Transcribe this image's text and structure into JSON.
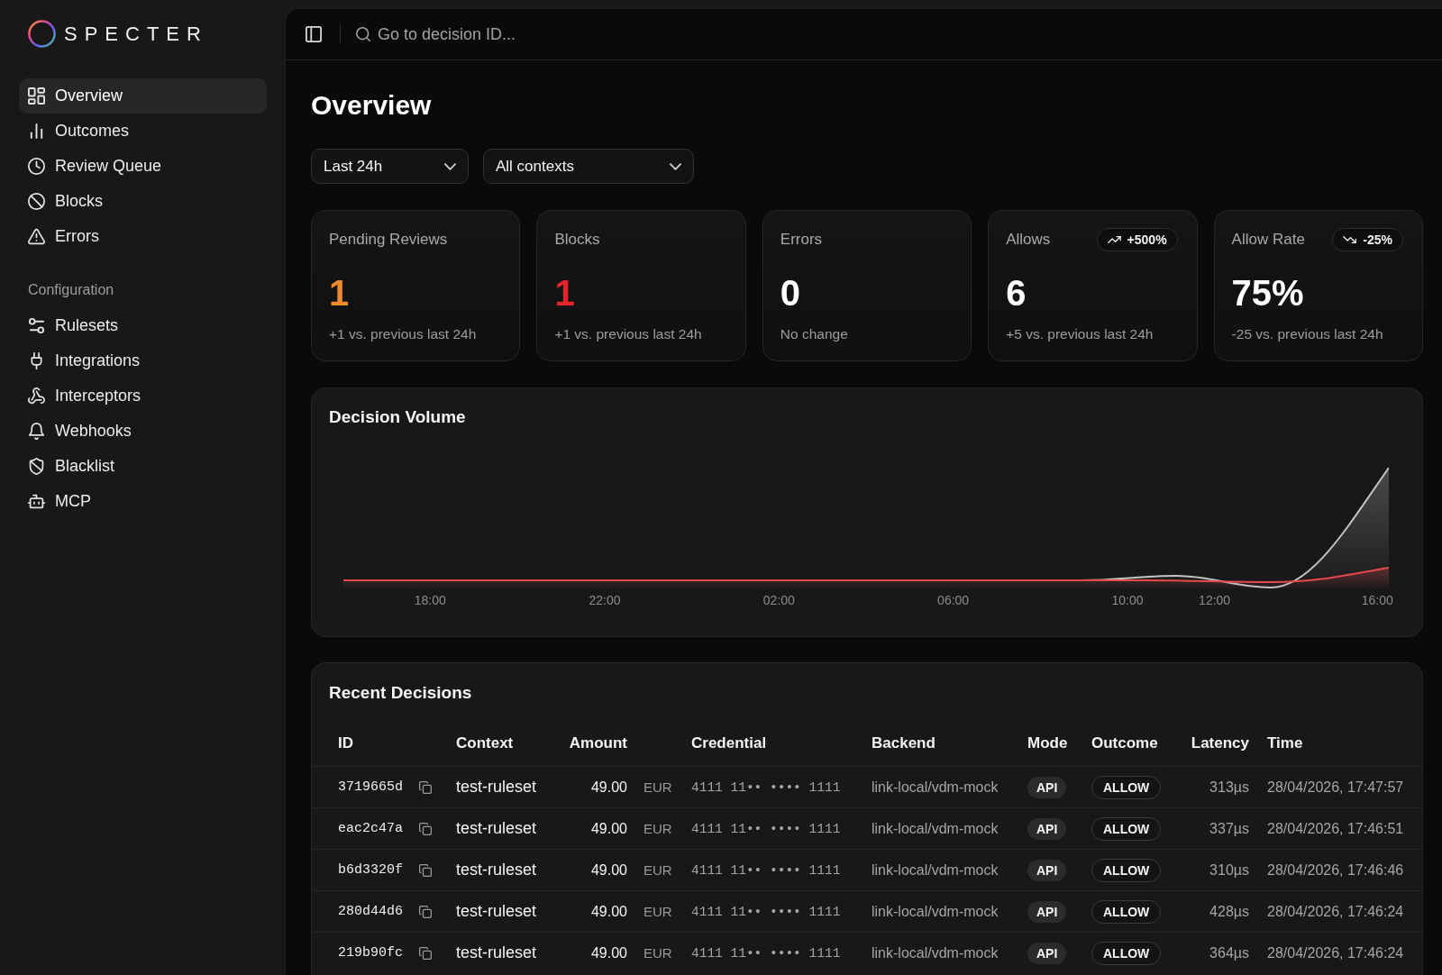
{
  "sidebar": {
    "logo": "SPECTER",
    "nav": [
      {
        "label": "Overview",
        "selected": true
      },
      {
        "label": "Outcomes",
        "selected": false
      },
      {
        "label": "Review Queue",
        "selected": false
      },
      {
        "label": "Blocks",
        "selected": false
      },
      {
        "label": "Errors",
        "selected": false
      }
    ],
    "sections": [
      {
        "title": "Configuration",
        "items": [
          {
            "label": "Rulesets",
            "selected": false
          },
          {
            "label": "Integrations",
            "selected": false
          },
          {
            "label": "Interceptors",
            "selected": false
          },
          {
            "label": "Webhooks",
            "selected": false
          },
          {
            "label": "Blacklist",
            "selected": false
          },
          {
            "label": "MCP",
            "selected": false
          }
        ]
      }
    ]
  },
  "topbar": {
    "search": {
      "placeholder": "Go to decision ID..."
    }
  },
  "page": {
    "title": "Overview"
  },
  "filters": [
    {
      "value": "Last 24h"
    },
    {
      "value": "All contexts"
    }
  ],
  "stats": [
    {
      "label": "Pending Reviews",
      "value": "1",
      "color": "#ef8a2c",
      "change": "+1 vs. previous last 24h"
    },
    {
      "label": "Blocks",
      "value": "1",
      "color": "#e5242a",
      "change": "+1 vs. previous last 24h"
    },
    {
      "label": "Errors",
      "value": "0",
      "color": "#ffffff",
      "change": "No change"
    },
    {
      "label": "Allows",
      "value": "6",
      "color": "#ffffff",
      "badge": {
        "text": "+500%",
        "rising": true
      },
      "change": "+5 vs. previous last 24h"
    },
    {
      "label": "Allow Rate",
      "value": "75%",
      "color": "#ffffff",
      "badge": {
        "text": "-25%",
        "rising": false
      },
      "change": "-25 vs. previous last 24h"
    }
  ],
  "chart": {
    "title": "Decision Volume",
    "axis_labels": [
      "18:00",
      "22:00",
      "02:00",
      "06:00",
      "10:00",
      "12:00",
      "16:00"
    ]
  },
  "table": {
    "title": "Recent Decisions",
    "columns": [
      "ID",
      "Context",
      "Amount",
      "Credential",
      "Backend",
      "Mode",
      "Outcome",
      "Latency",
      "Time"
    ],
    "rows": [
      {
        "id": "3719665d",
        "context": "test-ruleset",
        "amount": "49.00",
        "currency": "EUR",
        "credential": "4111 11•• •••• 1111",
        "backend": "link-local/vdm-mock",
        "mode": "API",
        "outcome": "ALLOW",
        "latency": "313µs",
        "time": "28/04/2026, 17:47:57"
      },
      {
        "id": "eac2c47a",
        "context": "test-ruleset",
        "amount": "49.00",
        "currency": "EUR",
        "credential": "4111 11•• •••• 1111",
        "backend": "link-local/vdm-mock",
        "mode": "API",
        "outcome": "ALLOW",
        "latency": "337µs",
        "time": "28/04/2026, 17:46:51"
      },
      {
        "id": "b6d3320f",
        "context": "test-ruleset",
        "amount": "49.00",
        "currency": "EUR",
        "credential": "4111 11•• •••• 1111",
        "backend": "link-local/vdm-mock",
        "mode": "API",
        "outcome": "ALLOW",
        "latency": "310µs",
        "time": "28/04/2026, 17:46:46"
      },
      {
        "id": "280d44d6",
        "context": "test-ruleset",
        "amount": "49.00",
        "currency": "EUR",
        "credential": "4111 11•• •••• 1111",
        "backend": "link-local/vdm-mock",
        "mode": "API",
        "outcome": "ALLOW",
        "latency": "428µs",
        "time": "28/04/2026, 17:46:24"
      },
      {
        "id": "219b90fc",
        "context": "test-ruleset",
        "amount": "49.00",
        "currency": "EUR",
        "credential": "4111 11•• •••• 1111",
        "backend": "link-local/vdm-mock",
        "mode": "API",
        "outcome": "ALLOW",
        "latency": "364µs",
        "time": "28/04/2026, 17:46:24"
      }
    ]
  }
}
